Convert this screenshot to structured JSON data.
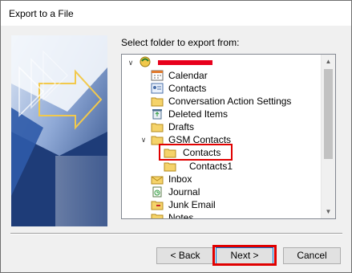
{
  "dialog": {
    "title": "Export to a File",
    "prompt": "Select folder to export from:"
  },
  "tree": {
    "items": [
      {
        "label": "",
        "icon": "mailbox-root-icon",
        "expander": "collapse",
        "level": 0
      },
      {
        "label": "Calendar",
        "icon": "calendar-icon",
        "level": 1
      },
      {
        "label": "Contacts",
        "icon": "contacts-icon",
        "level": 1
      },
      {
        "label": "Conversation Action Settings",
        "icon": "folder-icon",
        "level": 1
      },
      {
        "label": "Deleted Items",
        "icon": "recycle-bin-icon",
        "level": 1
      },
      {
        "label": "Drafts",
        "icon": "folder-icon",
        "level": 1
      },
      {
        "label": "GSM Contacts",
        "icon": "folder-icon",
        "expander": "collapse",
        "level": 1
      },
      {
        "label": "Contacts",
        "icon": "folder-icon",
        "level": 2,
        "selected": true
      },
      {
        "label": "Contacts1",
        "icon": "folder-icon",
        "level": 2
      },
      {
        "label": "Inbox",
        "icon": "inbox-icon",
        "level": 1
      },
      {
        "label": "Journal",
        "icon": "journal-icon",
        "level": 1
      },
      {
        "label": "Junk Email",
        "icon": "junk-email-icon",
        "level": 1
      },
      {
        "label": "Notes",
        "icon": "notes-icon",
        "level": 1
      }
    ]
  },
  "buttons": {
    "back": "< Back",
    "next": "Next >",
    "cancel": "Cancel"
  },
  "colors": {
    "highlight": "#e00000",
    "redaction": "#e8001c",
    "folder": "#f5d36a",
    "banner": "#2b4f8e"
  }
}
